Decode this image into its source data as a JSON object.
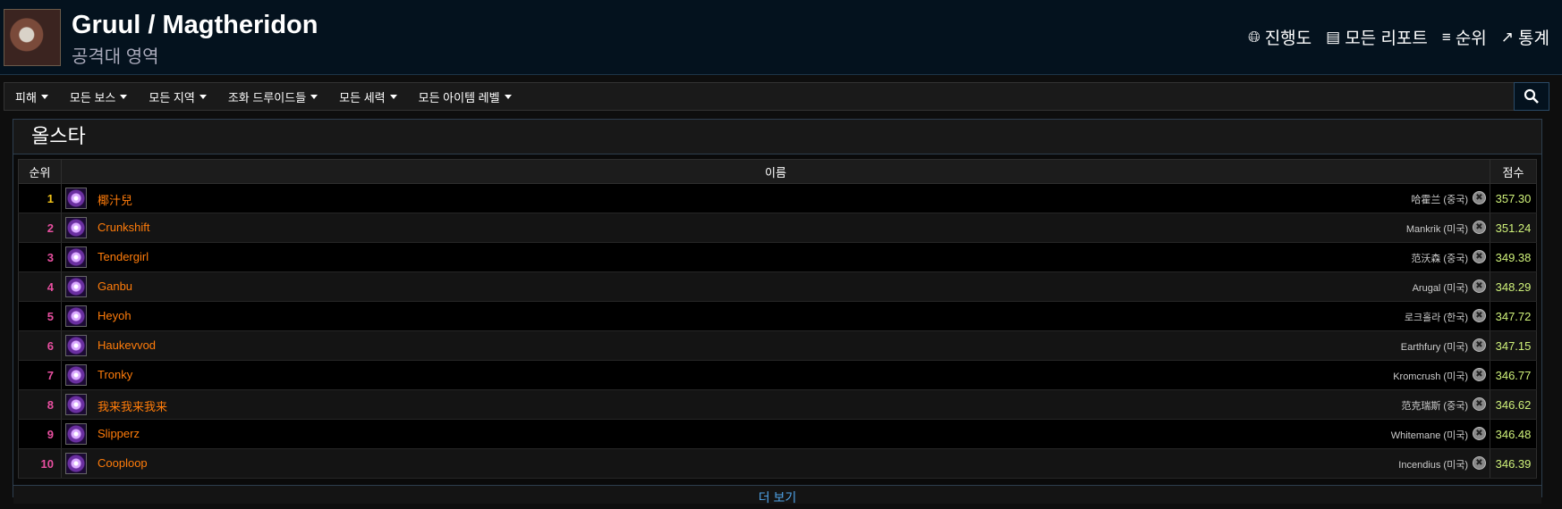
{
  "header": {
    "title": "Gruul / Magtheridon",
    "subtitle": "공격대 영역",
    "nav": [
      {
        "label": "진행도",
        "icon": "globe-icon"
      },
      {
        "label": "모든 리포트",
        "icon": "reports-icon"
      },
      {
        "label": "순위",
        "icon": "rankings-icon"
      },
      {
        "label": "통계",
        "icon": "trend-icon"
      }
    ]
  },
  "filters": [
    "피해",
    "모든 보스",
    "모든 지역",
    "조화 드루이드들",
    "모든 세력",
    "모든 아이템 레벨"
  ],
  "panel": {
    "title": "올스타",
    "columns": {
      "rank": "순위",
      "name": "이름",
      "score": "점수"
    },
    "rows": [
      {
        "rank": "1",
        "name": "椰汁兒",
        "server": "哈霍兰 (중국)",
        "score": "357.30"
      },
      {
        "rank": "2",
        "name": "Crunkshift",
        "server": "Mankrik (미국)",
        "score": "351.24"
      },
      {
        "rank": "3",
        "name": "Tendergirl",
        "server": "范沃森 (중국)",
        "score": "349.38"
      },
      {
        "rank": "4",
        "name": "Ganbu",
        "server": "Arugal (미국)",
        "score": "348.29"
      },
      {
        "rank": "5",
        "name": "Heyoh",
        "server": "로크홀라 (한국)",
        "score": "347.72"
      },
      {
        "rank": "6",
        "name": "Haukevvod",
        "server": "Earthfury (미국)",
        "score": "347.15"
      },
      {
        "rank": "7",
        "name": "Tronky",
        "server": "Kromcrush (미국)",
        "score": "346.77"
      },
      {
        "rank": "8",
        "name": "我来我来我来",
        "server": "范克瑞斯 (중국)",
        "score": "346.62"
      },
      {
        "rank": "9",
        "name": "Slipperz",
        "server": "Whitemane (미국)",
        "score": "346.48"
      },
      {
        "rank": "10",
        "name": "Cooploop",
        "server": "Incendius (미국)",
        "score": "346.39"
      }
    ],
    "more_label": "더 보기"
  }
}
